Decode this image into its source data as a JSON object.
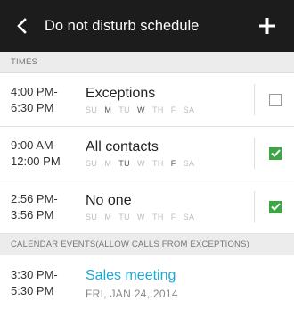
{
  "header": {
    "back_icon": "back-chevron-icon",
    "title": "Do not disturb schedule",
    "add_icon": "plus-icon"
  },
  "sections": {
    "times_label": "TIMES",
    "calendar_label": "CALENDAR EVENTS(ALLOW CALLS FROM EXCEPTIONS)"
  },
  "schedules": [
    {
      "start": "4:00 PM-",
      "end": "6:30 PM",
      "name": "Exceptions",
      "days": [
        {
          "label": "SU",
          "active": false
        },
        {
          "label": "M",
          "active": true
        },
        {
          "label": "TU",
          "active": false
        },
        {
          "label": "W",
          "active": true
        },
        {
          "label": "TH",
          "active": false
        },
        {
          "label": "F",
          "active": false
        },
        {
          "label": "SA",
          "active": false
        }
      ],
      "enabled": false
    },
    {
      "start": "9:00 AM-",
      "end": "12:00 PM",
      "name": "All contacts",
      "days": [
        {
          "label": "SU",
          "active": false
        },
        {
          "label": "M",
          "active": false
        },
        {
          "label": "TU",
          "active": true
        },
        {
          "label": "W",
          "active": false
        },
        {
          "label": "TH",
          "active": false
        },
        {
          "label": "F",
          "active": true
        },
        {
          "label": "SA",
          "active": false
        }
      ],
      "enabled": true
    },
    {
      "start": "2:56 PM-",
      "end": "3:56 PM",
      "name": "No one",
      "days": [
        {
          "label": "SU",
          "active": false
        },
        {
          "label": "M",
          "active": false
        },
        {
          "label": "TU",
          "active": false
        },
        {
          "label": "W",
          "active": false
        },
        {
          "label": "TH",
          "active": false
        },
        {
          "label": "F",
          "active": false
        },
        {
          "label": "SA",
          "active": false
        }
      ],
      "enabled": true
    }
  ],
  "calendar_events": [
    {
      "start": "3:30 PM-",
      "end": "5:30 PM",
      "name": "Sales meeting",
      "date": "FRI, JAN 24, 2014"
    }
  ],
  "colors": {
    "header_bg": "#1c1c1c",
    "check_green": "#3ba642",
    "event_blue": "#1aa9d6"
  }
}
